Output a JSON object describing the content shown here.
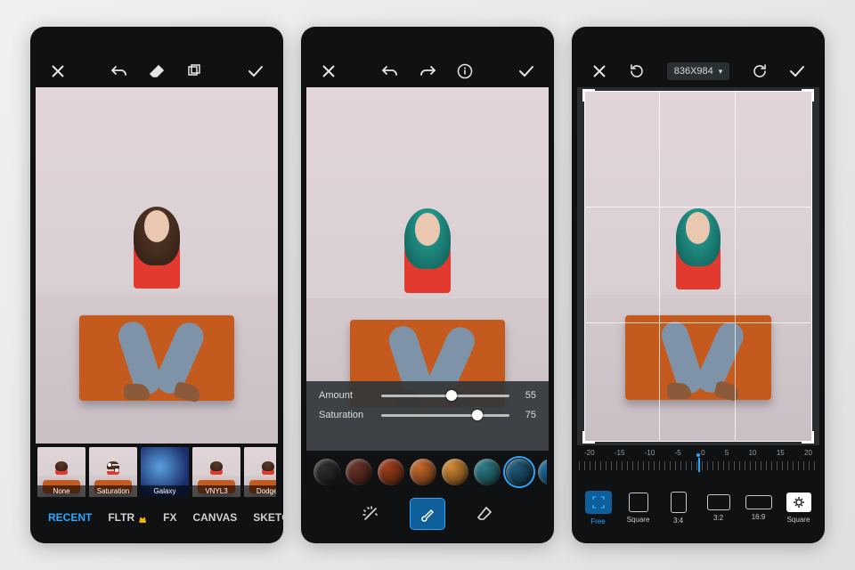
{
  "screen1": {
    "toolbar": {
      "close": "✕",
      "undo": "↶",
      "erase": "◧",
      "layers": "❐",
      "confirm": "✓"
    },
    "filters": [
      {
        "label": "None"
      },
      {
        "label": "Saturation",
        "selected": true
      },
      {
        "label": "Galaxy"
      },
      {
        "label": "VNYL3"
      },
      {
        "label": "Dodger"
      }
    ],
    "tabs": [
      {
        "label": "RECENT",
        "active": true
      },
      {
        "label": "FLTR",
        "premium": true
      },
      {
        "label": "FX"
      },
      {
        "label": "CANVAS"
      },
      {
        "label": "SKETCH"
      }
    ]
  },
  "screen2": {
    "toolbar": {
      "close": "✕",
      "undo": "↶",
      "redo": "↷",
      "info": "ⓘ",
      "confirm": "✓"
    },
    "sliders": [
      {
        "label": "Amount",
        "value": 55
      },
      {
        "label": "Saturation",
        "value": 75
      }
    ],
    "swatches": [
      "#2e2e2e",
      "#6a3326",
      "#a2401e",
      "#c96a2a",
      "#d58a34",
      "#2d7d88",
      "#1f5a7c",
      "#1b6a9a",
      "#5a3a7a",
      "#7a2e55"
    ],
    "swatch_selected_index": 6,
    "tools": [
      "wand",
      "brush",
      "eraser"
    ],
    "tool_active_index": 1
  },
  "screen3": {
    "toolbar": {
      "close": "✕",
      "reset": "⟳",
      "dimensions": "836X984",
      "dropdown": "▾",
      "rotate": "↻",
      "confirm": "✓"
    },
    "angle": {
      "labels": [
        "-20",
        "-15",
        "-10",
        "-5",
        "0",
        "5",
        "10",
        "15",
        "20"
      ],
      "value": 0
    },
    "aspects": [
      {
        "label": "Free",
        "kind": "free",
        "selected": true
      },
      {
        "label": "Square",
        "kind": "box",
        "ratio": "1:1"
      },
      {
        "label": "3:4",
        "kind": "box",
        "ratio": "3:4"
      },
      {
        "label": "3:2",
        "kind": "box",
        "ratio": "3:2"
      },
      {
        "label": "16:9",
        "kind": "box",
        "ratio": "16:9"
      },
      {
        "label": "Square",
        "kind": "gear"
      }
    ]
  }
}
